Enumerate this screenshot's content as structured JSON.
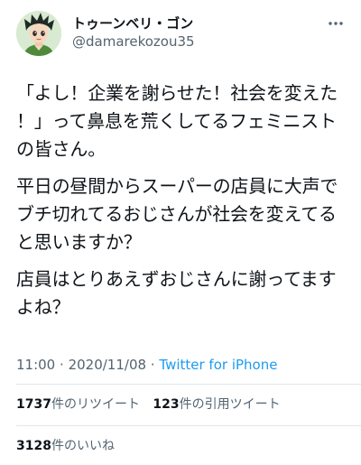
{
  "colors": {
    "link": "#1d9bf0",
    "secondary_text": "#536471",
    "primary_text": "#0f1419"
  },
  "user": {
    "display_name": "トゥーンベリ・ゴン",
    "handle": "@damarekozou35",
    "avatar_icon": "anime-boy-avatar"
  },
  "tweet": {
    "paragraphs": [
      "「よし！企業を謝らせた！社会を変えた！」って鼻息を荒くしてるフェミニストの皆さん。",
      "平日の昼間からスーパーの店員に大声でブチ切れてるおじさんが社会を変えてると思いますか？",
      "店員はとりあえずおじさんに謝ってますよね？"
    ],
    "time": "11:00",
    "separator": "·",
    "date": "2020/11/08",
    "client": "Twitter for iPhone"
  },
  "stats": {
    "retweets_count": "1737",
    "retweets_label": "件のリツイート",
    "quotes_count": "123",
    "quotes_label": "件の引用ツイート",
    "likes_count": "3128",
    "likes_label": "件のいいね"
  },
  "more_icon": "more-horizontal-icon"
}
